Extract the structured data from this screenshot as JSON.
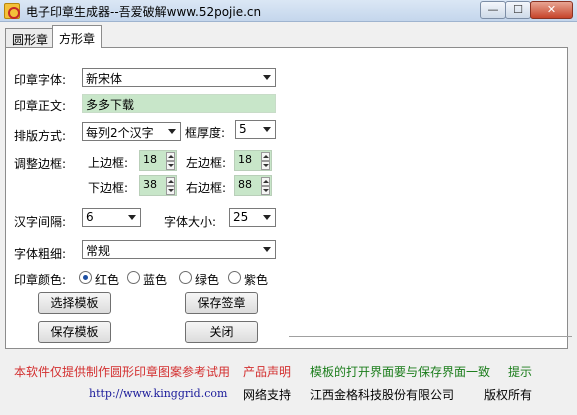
{
  "window": {
    "title": "电子印章生成器--吾爱破解www.52pojie.cn",
    "minimize_glyph": "—",
    "maximize_glyph": "☐",
    "close_glyph": "✕"
  },
  "tabs": [
    {
      "label": "圆形章",
      "active": false
    },
    {
      "label": "方形章",
      "active": true
    }
  ],
  "form": {
    "font_label": "印章字体:",
    "font_value": "新宋体",
    "text_label": "印章正文:",
    "text_value": "多多下载",
    "layout_label": "排版方式:",
    "layout_value": "每列2个汉字",
    "border_thickness_label": "框厚度:",
    "border_thickness_value": "5",
    "adjust_border_label": "调整边框:",
    "top_label": "上边框:",
    "top_value": "18",
    "left_label": "左边框:",
    "left_value": "18",
    "bottom_label": "下边框:",
    "bottom_value": "38",
    "right_label": "右边框:",
    "right_value": "88",
    "spacing_label": "汉字间隔:",
    "spacing_value": "6",
    "font_size_label": "字体大小:",
    "font_size_value": "25",
    "weight_label": "字体粗细:",
    "weight_value": "常规",
    "color_label": "印章颜色:",
    "colors": [
      {
        "label": "红色",
        "checked": true
      },
      {
        "label": "蓝色",
        "checked": false
      },
      {
        "label": "绿色",
        "checked": false
      },
      {
        "label": "紫色",
        "checked": false
      }
    ]
  },
  "buttons": {
    "select_template": "选择模板",
    "save_seal": "保存签章",
    "save_template": "保存模板",
    "close": "关闭"
  },
  "footer": {
    "disclaimer": "本软件仅提供制作圆形印章图案参考试用",
    "product_statement": "产品声明",
    "template_note": "模板的打开界面要与保存界面一致",
    "tip": "提示",
    "url": "http://www.kinggrid.com",
    "network_support": "网络支持",
    "company": "江西金格科技股份有限公司",
    "copyright": "版权所有"
  },
  "colors": {
    "red_text": "#d32f2f",
    "green_text": "#1b7d1b",
    "input_green": "#c8e6c9",
    "link_blue": "#1a1a9a"
  }
}
